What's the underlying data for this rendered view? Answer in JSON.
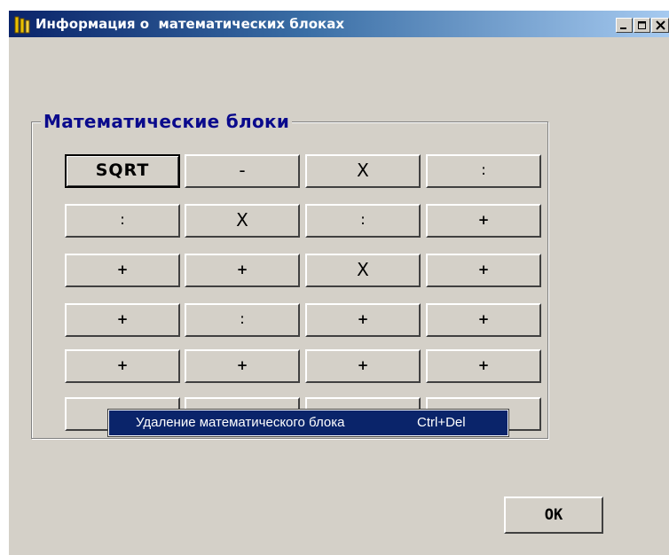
{
  "window": {
    "title": "Информация о  математических блоках",
    "minimize_label": "_",
    "maximize_label": "□",
    "close_label": "X"
  },
  "group": {
    "title": "Математические блоки"
  },
  "blocks": [
    [
      "SQRT",
      "-",
      "X",
      ":"
    ],
    [
      ":",
      "X",
      ":",
      "+"
    ],
    [
      "+",
      "+",
      "X",
      "+"
    ],
    [
      "+",
      ":",
      "+",
      "+"
    ],
    [
      "+",
      "+",
      "+",
      "+"
    ],
    [
      "",
      "",
      "",
      ""
    ]
  ],
  "context_menu": {
    "item_label": "Удаление математического блока",
    "item_shortcut": "Ctrl+Del"
  },
  "ok_label": "OK",
  "colors": {
    "face": "#d4d0c8",
    "title_start": "#0a246a",
    "title_end": "#a6caf0",
    "group_title": "#0a0a8c",
    "menu_highlight": "#0a246a"
  }
}
